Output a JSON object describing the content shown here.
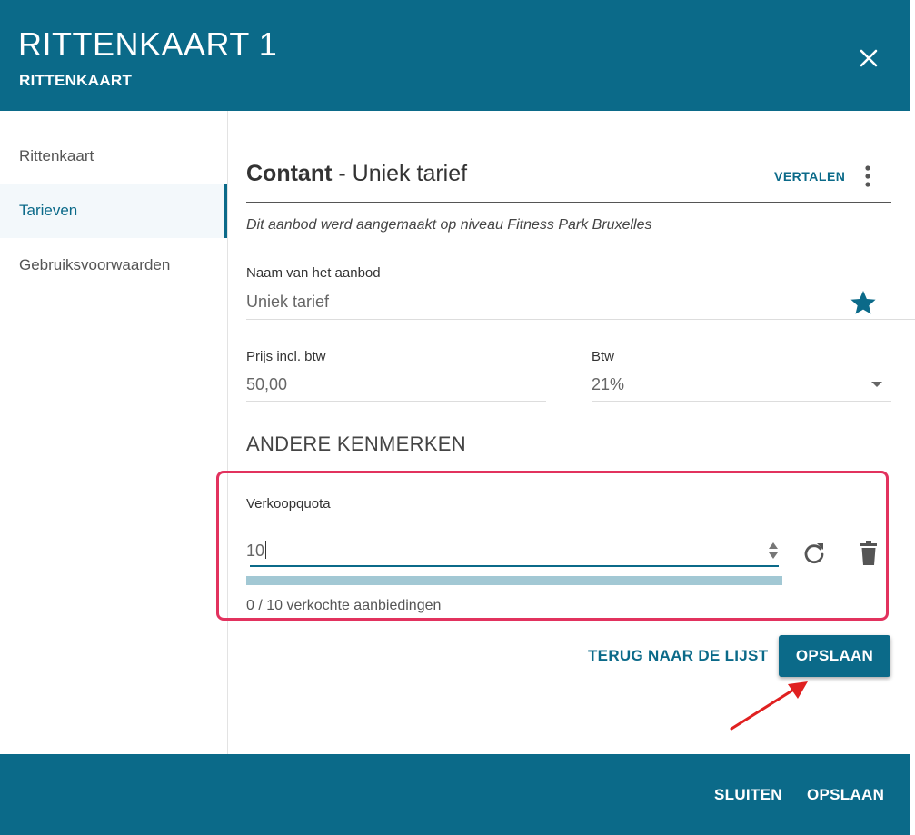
{
  "header": {
    "title": "RITTENKAART 1",
    "subtitle": "RITTENKAART",
    "close_icon": "close-icon"
  },
  "sidebar": {
    "items": [
      {
        "label": "Rittenkaart",
        "active": false
      },
      {
        "label": "Tarieven",
        "active": true
      },
      {
        "label": "Gebruiksvoorwaarden",
        "active": false
      }
    ]
  },
  "content": {
    "title_bold": "Contant",
    "title_rest": " - Uniek tarief",
    "translate_label": "VERTALEN",
    "more_icon": "more-vertical-icon",
    "note": "Dit aanbod werd aangemaakt op niveau Fitness Park Bruxelles",
    "name_field": {
      "label": "Naam van het aanbod",
      "value": "Uniek tarief",
      "icon": "star-icon"
    },
    "price_field": {
      "label": "Prijs incl. btw",
      "value": "50,00"
    },
    "vat_field": {
      "label": "Btw",
      "value": "21%",
      "icon": "dropdown-caret-icon"
    },
    "section_title": "ANDERE KENMERKEN",
    "quota": {
      "label": "Verkoopquota",
      "value": "10",
      "status": "0 / 10 verkochte aanbiedingen",
      "progress": 0.0,
      "icons": [
        "spinner-icon",
        "refresh-icon",
        "trash-icon"
      ]
    },
    "back_button": "TERUG NAAR DE LIJST",
    "save_button": "OPSLAAN"
  },
  "footer": {
    "close_button": "SLUITEN",
    "save_button": "OPSLAAN"
  },
  "colors": {
    "primary": "#0b6a89",
    "highlight": "#e2325e",
    "annotation_arrow": "#e02020"
  }
}
